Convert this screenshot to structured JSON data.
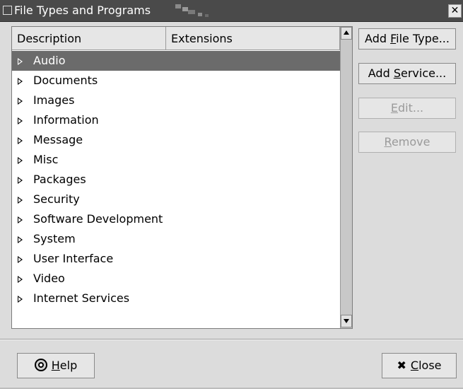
{
  "window": {
    "title": "File Types and Programs",
    "close_glyph": "✕",
    "icon": "window-menu-icon"
  },
  "table": {
    "columns": [
      "Description",
      "Extensions"
    ],
    "rows": [
      {
        "label": "Audio",
        "selected": true
      },
      {
        "label": "Documents",
        "selected": false
      },
      {
        "label": "Images",
        "selected": false
      },
      {
        "label": "Information",
        "selected": false
      },
      {
        "label": "Message",
        "selected": false
      },
      {
        "label": "Misc",
        "selected": false
      },
      {
        "label": "Packages",
        "selected": false
      },
      {
        "label": "Security",
        "selected": false
      },
      {
        "label": "Software Development",
        "selected": false
      },
      {
        "label": "System",
        "selected": false
      },
      {
        "label": "User Interface",
        "selected": false
      },
      {
        "label": "Video",
        "selected": false
      },
      {
        "label": "Internet Services",
        "selected": false
      }
    ]
  },
  "actions": {
    "add_file_type": {
      "pre": "Add ",
      "key": "F",
      "post": "ile Type...",
      "enabled": true
    },
    "add_service": {
      "pre": "Add ",
      "key": "S",
      "post": "ervice...",
      "enabled": true
    },
    "edit": {
      "pre": "",
      "key": "E",
      "post": "dit...",
      "enabled": false
    },
    "remove": {
      "pre": "",
      "key": "R",
      "post": "emove",
      "enabled": false
    }
  },
  "footer": {
    "help": {
      "pre": "",
      "key": "H",
      "post": "elp",
      "icon": "help-lifebuoy-icon"
    },
    "close": {
      "pre": "",
      "key": "C",
      "post": "lose",
      "icon": "close-x-icon",
      "glyph": "✖"
    }
  },
  "colors": {
    "titlebar": "#4a4a4a",
    "selection": "#6b6b6b",
    "background": "#dcdcdc"
  }
}
